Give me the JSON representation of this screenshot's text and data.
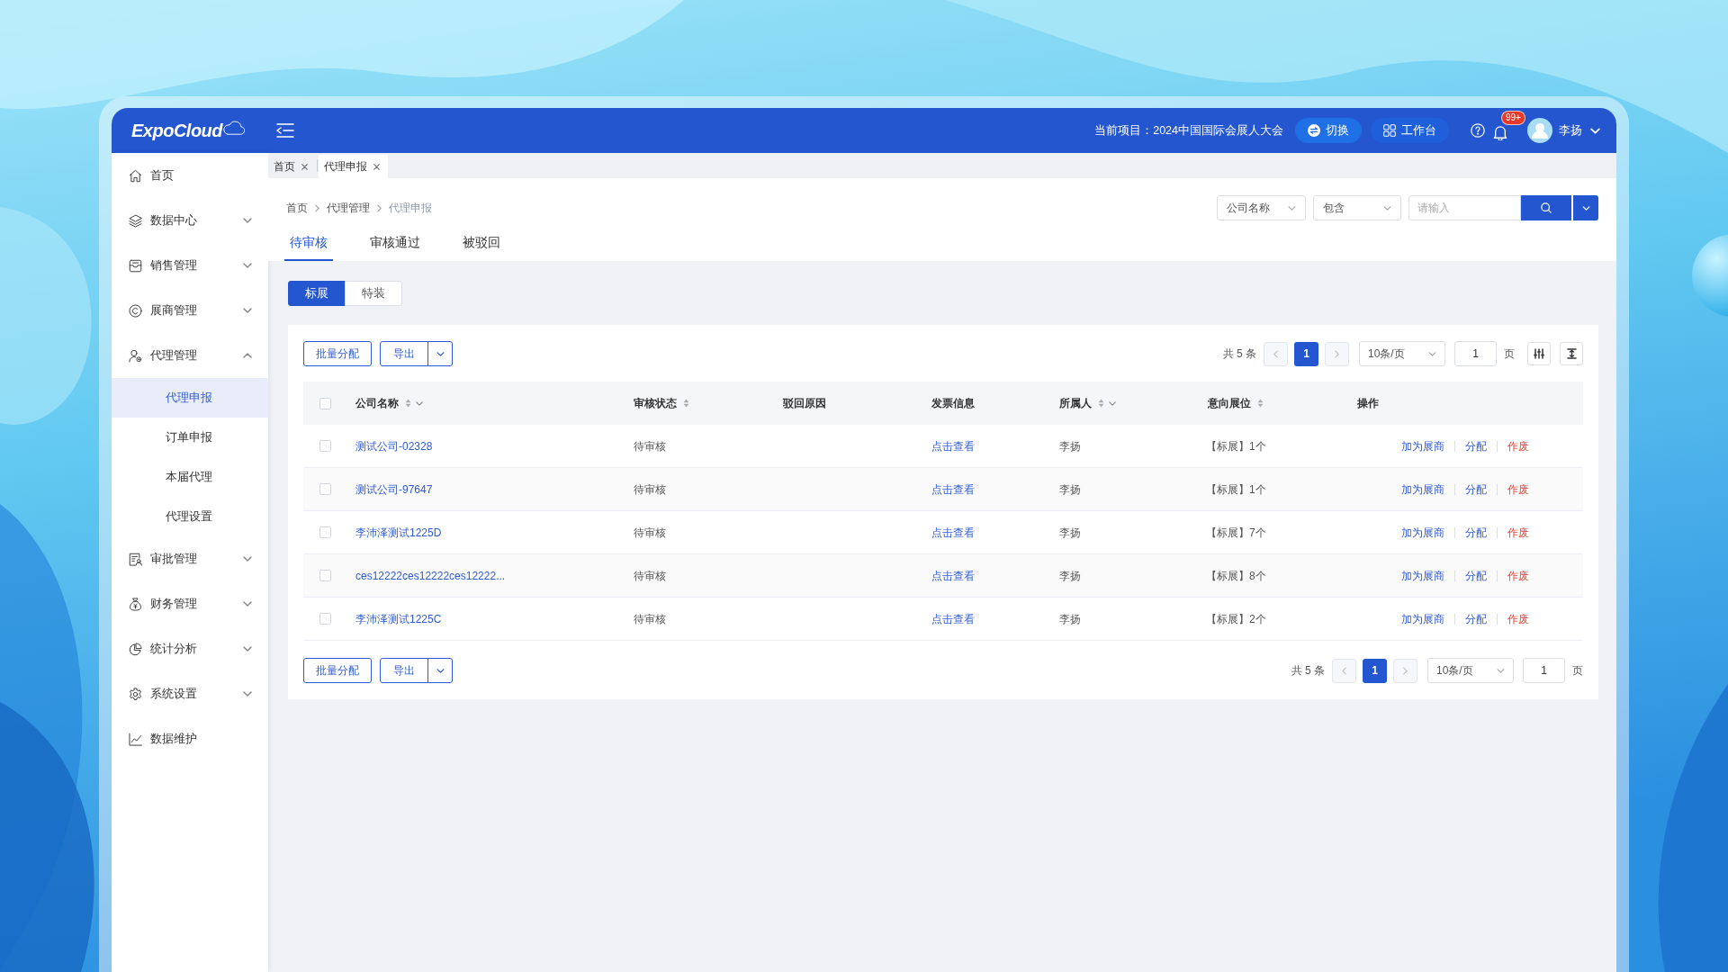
{
  "header": {
    "logo": "ExpoCloud",
    "project": "当前项目：2024中国国际会展人大会",
    "buttons": [
      {
        "label": "切换",
        "kind": "switch"
      },
      {
        "label": "工作台",
        "kind": "workbench"
      }
    ],
    "notification_badge": "99+",
    "user_name": "李扬"
  },
  "sidebar": {
    "items": [
      {
        "label": "首页",
        "kind": "link",
        "selected": false
      },
      {
        "label": "数据中心",
        "kind": "group",
        "selected": false,
        "expanded": false
      },
      {
        "label": "销售管理",
        "kind": "group",
        "selected": false,
        "expanded": false
      },
      {
        "label": "展商管理",
        "kind": "group",
        "selected": false,
        "expanded": false
      },
      {
        "label": "代理管理",
        "kind": "group",
        "selected": false,
        "expanded": true,
        "children": [
          {
            "label": "代理申报",
            "selected": true
          },
          {
            "label": "订单申报",
            "selected": false
          },
          {
            "label": "本届代理",
            "selected": false
          },
          {
            "label": "代理设置",
            "selected": false
          }
        ]
      },
      {
        "label": "审批管理",
        "kind": "group",
        "selected": false,
        "expanded": false
      },
      {
        "label": "财务管理",
        "kind": "group",
        "selected": false,
        "expanded": false
      },
      {
        "label": "统计分析",
        "kind": "group",
        "selected": false,
        "expanded": false
      },
      {
        "label": "系统设置",
        "kind": "group",
        "selected": false,
        "expanded": false
      },
      {
        "label": "数据维护",
        "kind": "link",
        "selected": false
      }
    ]
  },
  "page_tabs": [
    {
      "label": "首页",
      "selected": false
    },
    {
      "label": "代理申报",
      "selected": true
    }
  ],
  "breadcrumb": [
    "首页",
    "代理管理",
    "代理申报"
  ],
  "search": {
    "field": "公司名称",
    "operator": "包含",
    "placeholder": "请输入"
  },
  "status_tabs": [
    {
      "label": "待审核",
      "selected": true
    },
    {
      "label": "审核通过",
      "selected": false
    },
    {
      "label": "被驳回",
      "selected": false
    }
  ],
  "booth_type_toggle": [
    {
      "label": "标展",
      "selected": true
    },
    {
      "label": "特装",
      "selected": false
    }
  ],
  "toolbar_top": {
    "buttons": [
      {
        "label": "批量分配",
        "kind": "plain"
      },
      {
        "label": "导出",
        "kind": "split"
      }
    ],
    "pagination": {
      "total": "共 5 条",
      "prev_disabled": true,
      "pages": [
        {
          "label": "1",
          "selected": true
        }
      ],
      "next_disabled": true,
      "page_size": "10条/页",
      "jump_value": "1",
      "jump_suffix": "页"
    }
  },
  "table": {
    "select_all_checked": false,
    "columns": [
      {
        "label": "公司名称",
        "sortable": true,
        "filterable": true
      },
      {
        "label": "审核状态",
        "sortable": true,
        "filterable": false
      },
      {
        "label": "驳回原因",
        "sortable": false,
        "filterable": false
      },
      {
        "label": "发票信息",
        "sortable": false,
        "filterable": false
      },
      {
        "label": "所属人",
        "sortable": true,
        "filterable": true
      },
      {
        "label": "意向展位",
        "sortable": true,
        "filterable": false
      },
      {
        "label": "操作",
        "sortable": false,
        "filterable": false
      }
    ],
    "rows": [
      {
        "checked": false,
        "company": "测试公司-02328",
        "status": "待审核",
        "invoice": "点击查看",
        "owner": "李扬",
        "booth": "【标展】1个",
        "actions": [
          {
            "label": "加为展商",
            "kind": "link"
          },
          {
            "label": "分配",
            "kind": "link"
          },
          {
            "label": "作废",
            "kind": "danger"
          }
        ]
      },
      {
        "checked": false,
        "company": "测试公司-97647",
        "status": "待审核",
        "invoice": "点击查看",
        "owner": "李扬",
        "booth": "【标展】1个",
        "actions": [
          {
            "label": "加为展商",
            "kind": "link"
          },
          {
            "label": "分配",
            "kind": "link"
          },
          {
            "label": "作废",
            "kind": "danger"
          }
        ]
      },
      {
        "checked": false,
        "company": "李沛泽测试1225D",
        "status": "待审核",
        "invoice": "点击查看",
        "owner": "李扬",
        "booth": "【标展】7个",
        "actions": [
          {
            "label": "加为展商",
            "kind": "link"
          },
          {
            "label": "分配",
            "kind": "link"
          },
          {
            "label": "作废",
            "kind": "danger"
          }
        ]
      },
      {
        "checked": false,
        "company": "ces12222ces12222ces12222...",
        "status": "待审核",
        "invoice": "点击查看",
        "owner": "李扬",
        "booth": "【标展】8个",
        "actions": [
          {
            "label": "加为展商",
            "kind": "link"
          },
          {
            "label": "分配",
            "kind": "link"
          },
          {
            "label": "作废",
            "kind": "danger"
          }
        ]
      },
      {
        "checked": false,
        "company": "李沛泽测试1225C",
        "status": "待审核",
        "invoice": "点击查看",
        "owner": "李扬",
        "booth": "【标展】2个",
        "actions": [
          {
            "label": "加为展商",
            "kind": "link"
          },
          {
            "label": "分配",
            "kind": "link"
          },
          {
            "label": "作废",
            "kind": "danger"
          }
        ]
      }
    ]
  },
  "toolbar_bottom": {
    "buttons": [
      {
        "label": "批量分配",
        "kind": "plain"
      },
      {
        "label": "导出",
        "kind": "split"
      }
    ],
    "pagination": {
      "total": "共 5 条",
      "prev_disabled": true,
      "pages": [
        {
          "label": "1",
          "selected": true
        }
      ],
      "next_disabled": true,
      "page_size": "10条/页",
      "jump_value": "1",
      "jump_suffix": "页"
    }
  }
}
